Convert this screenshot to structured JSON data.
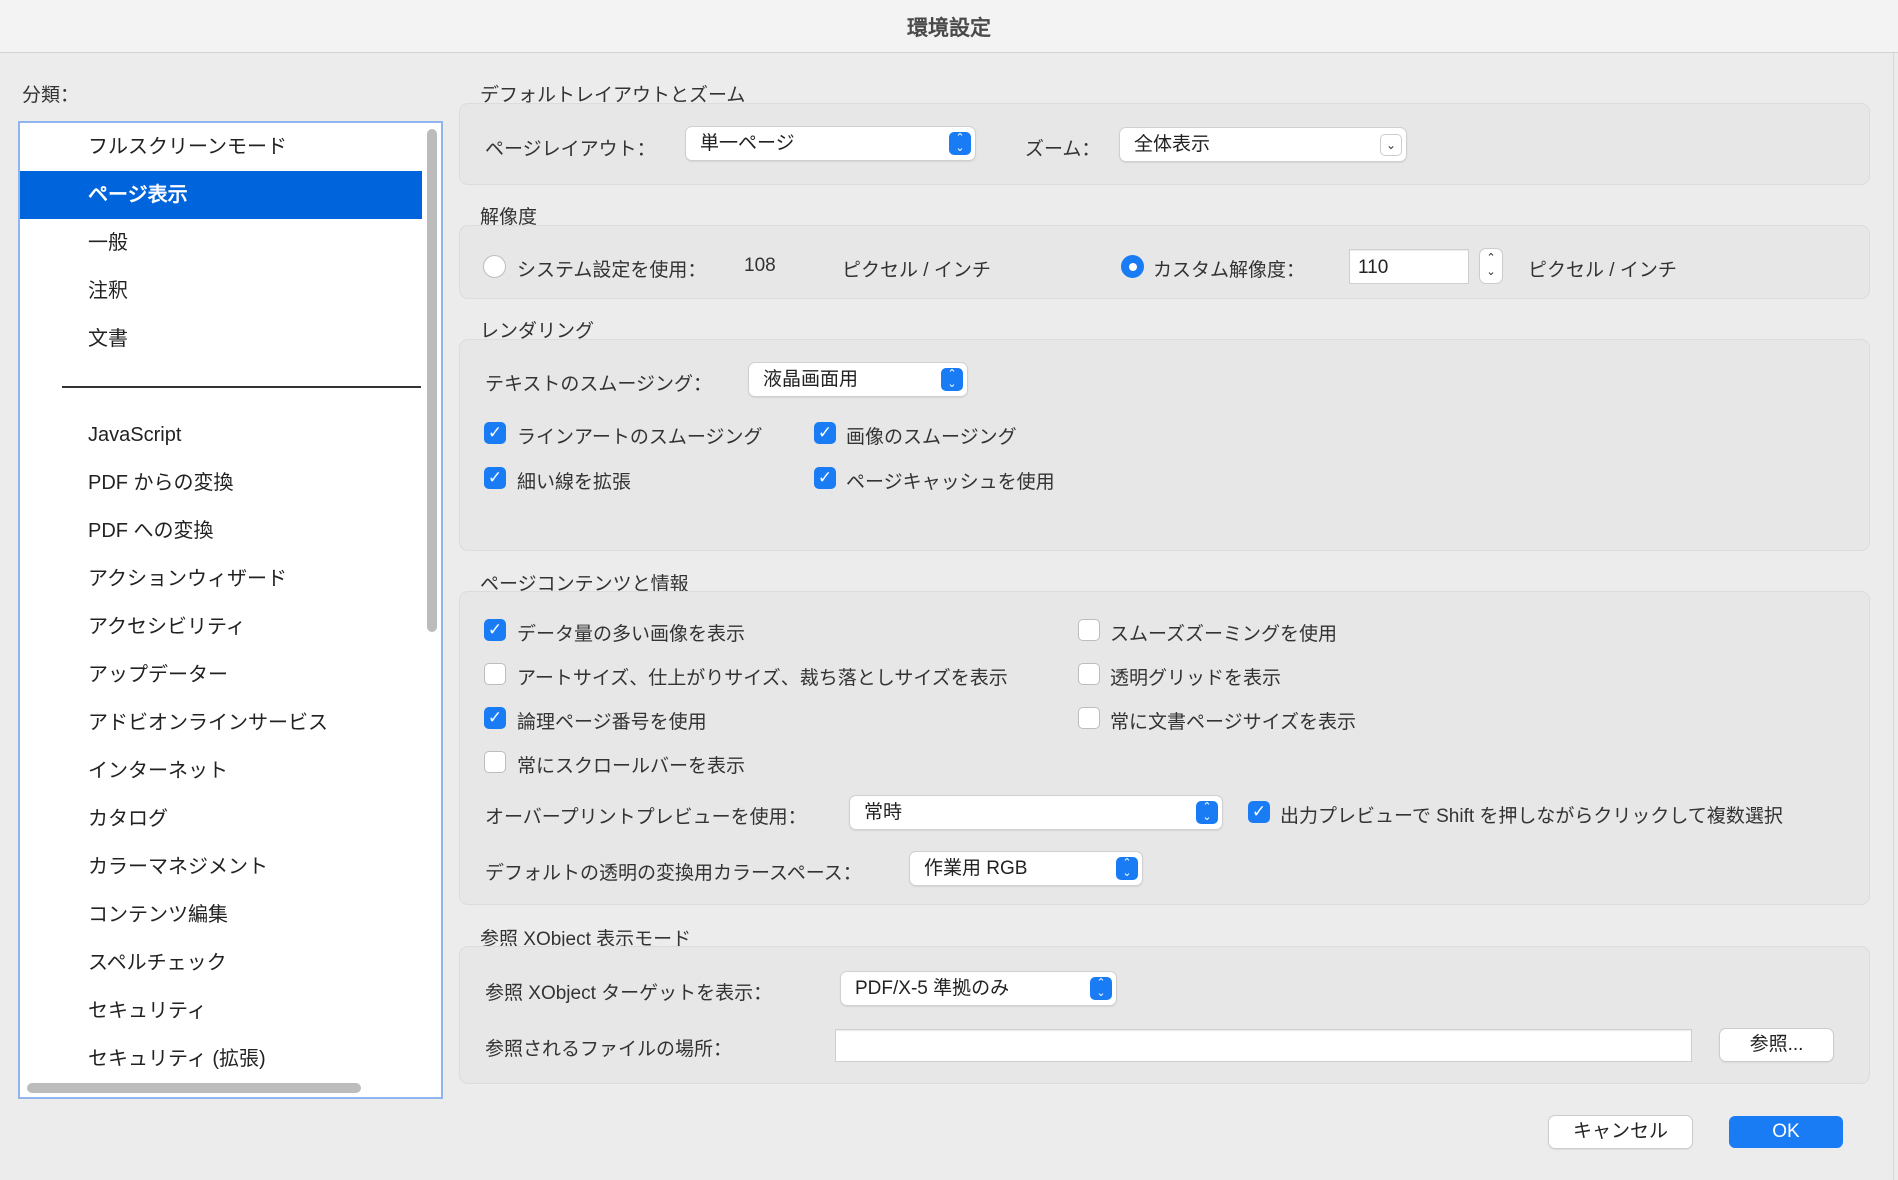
{
  "window": {
    "title": "環境設定"
  },
  "sidebar": {
    "label": "分類：",
    "items": [
      "フルスクリーンモード",
      "ページ表示",
      "一般",
      "注釈",
      "文書",
      "JavaScript",
      "PDF からの変換",
      "PDF への変換",
      "アクションウィザード",
      "アクセシビリティ",
      "アップデーター",
      "アドビオンラインサービス",
      "インターネット",
      "カタログ",
      "カラーマネジメント",
      "コンテンツ編集",
      "スペルチェック",
      "セキュリティ",
      "セキュリティ (拡張)"
    ],
    "selected": "ページ表示"
  },
  "layout_zoom": {
    "heading": "デフォルトレイアウトとズーム",
    "page_layout_label": "ページレイアウト：",
    "page_layout_value": "単一ページ",
    "zoom_label": "ズーム：",
    "zoom_value": "全体表示"
  },
  "resolution": {
    "heading": "解像度",
    "system_label": "システム設定を使用：",
    "system_value": "108",
    "system_unit": "ピクセル / インチ",
    "system_checked": false,
    "custom_label": "カスタム解像度：",
    "custom_value": "110",
    "custom_unit": "ピクセル / インチ",
    "custom_checked": true
  },
  "rendering": {
    "heading": "レンダリング",
    "smoothing_label": "テキストのスムージング：",
    "smoothing_value": "液晶画面用",
    "lineart": "ラインアートのスムージング",
    "images": "画像のスムージング",
    "thin_lines": "細い線を拡張",
    "page_cache": "ページキャッシュを使用"
  },
  "page_content": {
    "heading": "ページコンテンツと情報",
    "large_images": "データ量の多い画像を表示",
    "smooth_zoom": "スムーズズーミングを使用",
    "art_trim": "アートサイズ、仕上がりサイズ、裁ち落としサイズを表示",
    "transparency_grid": "透明グリッドを表示",
    "logical_page": "論理ページ番号を使用",
    "doc_page_size": "常に文書ページサイズを表示",
    "scrollbars": "常にスクロールバーを表示",
    "overprint_label": "オーバープリントプレビューを使用：",
    "overprint_value": "常時",
    "shift_click": "出力プレビューで Shift を押しながらクリックして複数選択",
    "blend_label": "デフォルトの透明の変換用カラースペース：",
    "blend_value": "作業用 RGB"
  },
  "xobject": {
    "heading": "参照 XObject 表示モード",
    "target_label": "参照 XObject ターゲットを表示：",
    "target_value": "PDF/X-5 準拠のみ",
    "location_label": "参照されるファイルの場所：",
    "location_value": "",
    "browse": "参照..."
  },
  "footer": {
    "cancel": "キャンセル",
    "ok": "OK"
  },
  "colors": {
    "accent": "#1a7cf5",
    "selection": "#0064dc"
  }
}
